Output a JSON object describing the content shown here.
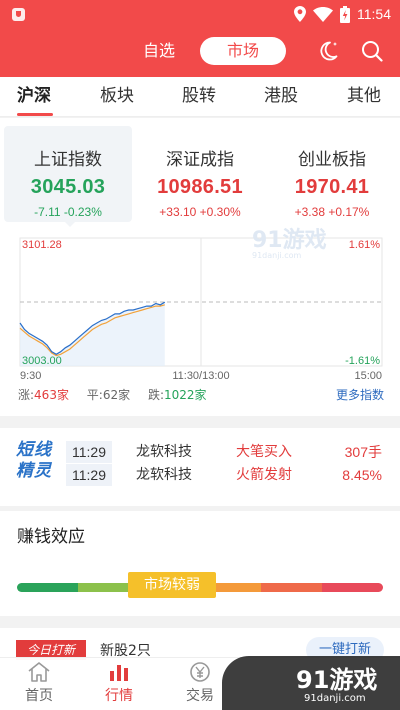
{
  "status_bar": {
    "time": "11:54"
  },
  "header": {
    "segments": [
      {
        "label": "自选"
      },
      {
        "label": "市场"
      }
    ]
  },
  "tabs": [
    {
      "label": "沪深"
    },
    {
      "label": "板块"
    },
    {
      "label": "股转"
    },
    {
      "label": "港股"
    },
    {
      "label": "其他"
    }
  ],
  "indices": [
    {
      "name": "上证指数",
      "value": "3045.03",
      "change": "-7.11 -0.23%",
      "direction": "down"
    },
    {
      "name": "深证成指",
      "value": "10986.51",
      "change": "+33.10 +0.30%",
      "direction": "up"
    },
    {
      "name": "创业板指",
      "value": "1970.41",
      "change": "+3.38 +0.17%",
      "direction": "up"
    }
  ],
  "chart_data": {
    "type": "line",
    "y_top_label": "3101.28",
    "y_bottom_label": "3003.00",
    "pct_top_label": "1.61%",
    "pct_bottom_label": "-1.61%",
    "x_tick_labels": [
      "9:30",
      "11:30/13:00",
      "15:00"
    ],
    "ylim": [
      3003.0,
      3101.28
    ],
    "prev_close": 3052.14,
    "series": [
      {
        "values": [
          3036,
          3031,
          3028,
          3026,
          3024,
          3022,
          3019,
          3014,
          3012,
          3014,
          3017,
          3019,
          3022,
          3025,
          3028,
          3031,
          3034,
          3036,
          3038,
          3039,
          3041,
          3043,
          3043,
          3045,
          3046,
          3046,
          3047,
          3048,
          3049,
          3049,
          3051,
          3050,
          3052
        ]
      },
      {
        "values": [
          3032,
          3029,
          3026,
          3024,
          3022,
          3020,
          3017,
          3013,
          3011,
          3012,
          3014,
          3016,
          3019,
          3022,
          3025,
          3028,
          3031,
          3033,
          3035,
          3036,
          3038,
          3040,
          3041,
          3042,
          3043,
          3044,
          3045,
          3046,
          3047,
          3048,
          3049,
          3049,
          3050
        ]
      }
    ],
    "colors": {
      "price": "#2a6fc9",
      "average": "#f2a23a",
      "up": "#e23c3c",
      "down": "#25a35b"
    }
  },
  "market_stats": {
    "up_label": "涨:",
    "up_count": "463家",
    "flat_label": "平:",
    "flat_count": "62家",
    "down_label": "跌:",
    "down_count": "1022家",
    "more_link": "更多指数"
  },
  "short_elves": {
    "logo": [
      "短线",
      "精灵"
    ],
    "rows": [
      {
        "time": "11:29",
        "name": "龙软科技",
        "signal": "大笔买入",
        "value": "307手"
      },
      {
        "time": "11:29",
        "name": "龙软科技",
        "signal": "火箭发射",
        "value": "8.45%"
      }
    ]
  },
  "money_effect": {
    "title": "赚钱效应",
    "badge": "市场较弱",
    "scale_colors": [
      "#2aa35a",
      "#8cc14b",
      "#f5c02a",
      "#f49a3a",
      "#ef6a4a",
      "#e84a5a"
    ]
  },
  "ipo": {
    "tag": "今日打新",
    "text": "新股2只",
    "button": "一键打新"
  },
  "bottom_nav": [
    {
      "label": "首页"
    },
    {
      "label": "行情"
    },
    {
      "label": "交易"
    }
  ],
  "watermark": {
    "text": "91游戏",
    "site": "91danji.com"
  }
}
